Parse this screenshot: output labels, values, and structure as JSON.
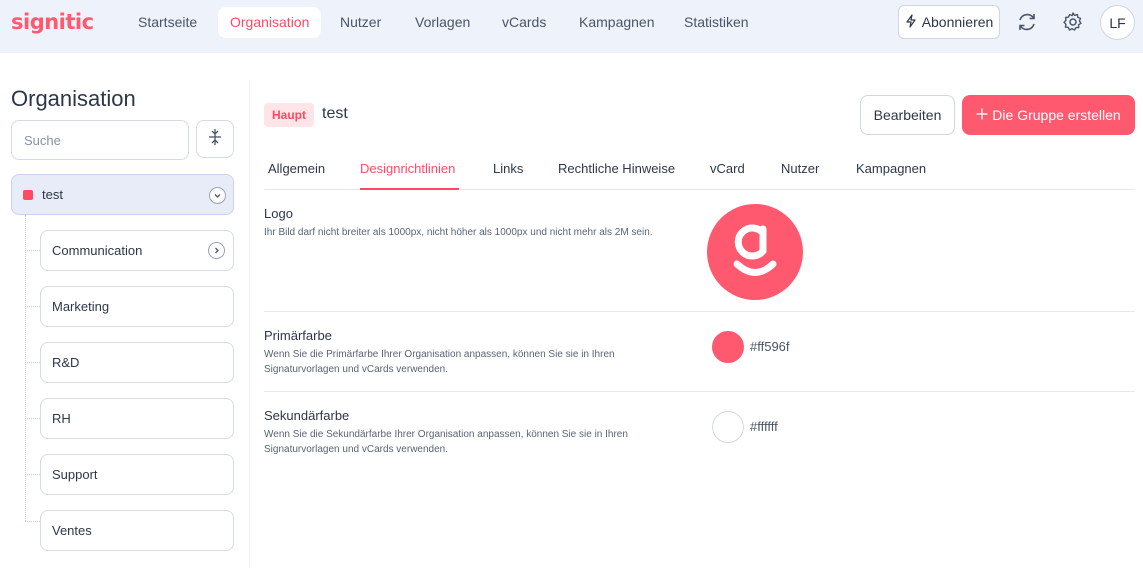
{
  "app": {
    "logo": "signitic"
  },
  "nav": [
    "Startseite",
    "Organisation",
    "Nutzer",
    "Vorlagen",
    "vCards",
    "Kampagnen",
    "Statistiken"
  ],
  "topbar": {
    "subscribe_label": "Abonnieren",
    "avatar_initials": "LF"
  },
  "sidebar": {
    "title": "Organisation",
    "search_placeholder": "Suche",
    "root": {
      "label": "test",
      "color": "#ff4a62"
    },
    "children": [
      "Communication",
      "Marketing",
      "R&D",
      "RH",
      "Support",
      "Ventes"
    ]
  },
  "header": {
    "badge": "Haupt",
    "group_name": "test",
    "edit_label": "Bearbeiten",
    "create_label": "Die Gruppe erstellen"
  },
  "tabs": [
    "Allgemein",
    "Designrichtlinien",
    "Links",
    "Rechtliche Hinweise",
    "vCard",
    "Nutzer",
    "Kampagnen"
  ],
  "active_tab": "Designrichtlinien",
  "settings": {
    "logo": {
      "title": "Logo",
      "description": "Ihr Bild darf nicht breiter als 1000px, nicht höher als 1000px und nicht mehr als 2M sein."
    },
    "primary": {
      "title": "Primärfarbe",
      "description": "Wenn Sie die Primärfarbe Ihrer Organisation anpassen, können Sie sie in Ihren Signaturvorlagen und vCards verwenden.",
      "hex": "#ff596f"
    },
    "secondary": {
      "title": "Sekundärfarbe",
      "description": "Wenn Sie die Sekundärfarbe Ihrer Organisation anpassen, können Sie sie in Ihren Signaturvorlagen und vCards verwenden.",
      "hex": "#ffffff"
    }
  },
  "colors": {
    "accent": "#ff596f",
    "topbar_bg": "#eef2fa"
  }
}
